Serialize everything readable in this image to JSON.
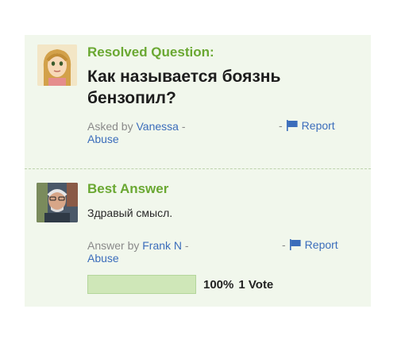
{
  "question": {
    "section_label": "Resolved Question:",
    "text": "Как называется боязнь бензопил?",
    "asked_by_prefix": "Asked by",
    "asker_name": "Vanessa",
    "separator": " -",
    "report_label": "Report",
    "abuse_label": "Abuse"
  },
  "answer": {
    "section_label": "Best Answer",
    "text": "Здравый смысл.",
    "answer_by_prefix": "Answer by",
    "answerer_name": "Frank N",
    "separator": " -",
    "report_label": "Report",
    "abuse_label": "Abuse"
  },
  "rating": {
    "percent_label": "100%",
    "votes_label": "1 Vote",
    "percent_value": 100
  },
  "icons": {
    "report": "flag-icon",
    "asker_avatar": "avatar-icon",
    "answerer_avatar": "avatar-icon"
  },
  "colors": {
    "card_bg": "#f1f7ec",
    "accent_green": "#6aa832",
    "link_blue": "#3b6dbb",
    "vote_bar": "#d6ecc2"
  }
}
